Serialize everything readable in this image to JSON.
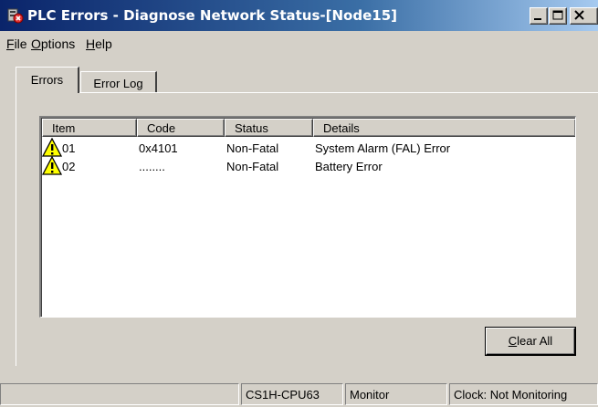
{
  "window": {
    "title": "PLC Errors - Diagnose Network Status-[Node15]"
  },
  "menu": {
    "items": [
      {
        "label": "File",
        "mnemonic": "F",
        "rest": "ile"
      },
      {
        "label": "Options",
        "mnemonic": "O",
        "rest": "ptions"
      },
      {
        "label": "Help",
        "mnemonic": "H",
        "rest": "elp"
      }
    ]
  },
  "tabs": [
    {
      "label": "Errors",
      "selected": true
    },
    {
      "label": "Error Log",
      "selected": false
    }
  ],
  "list": {
    "columns": [
      "Item",
      "Code",
      "Status",
      "Details"
    ],
    "rows": [
      {
        "item": "01",
        "code": "0x4101",
        "status": "Non-Fatal",
        "details": "System Alarm (FAL) Error",
        "icon": "warning-icon"
      },
      {
        "item": "02",
        "code": "........",
        "status": "Non-Fatal",
        "details": "Battery Error",
        "icon": "warning-icon"
      }
    ]
  },
  "buttons": {
    "clear_all": {
      "label": "Clear All",
      "mnemonic": "C",
      "rest": "lear All"
    }
  },
  "statusbar": {
    "cpu": "CS1H-CPU63",
    "mode": "Monitor",
    "clock": "Clock: Not Monitoring"
  },
  "colors": {
    "title_gradient_start": "#0a246a",
    "title_gradient_end": "#a6caf0",
    "face": "#d4d0c8",
    "warning_yellow": "#ffff00"
  }
}
